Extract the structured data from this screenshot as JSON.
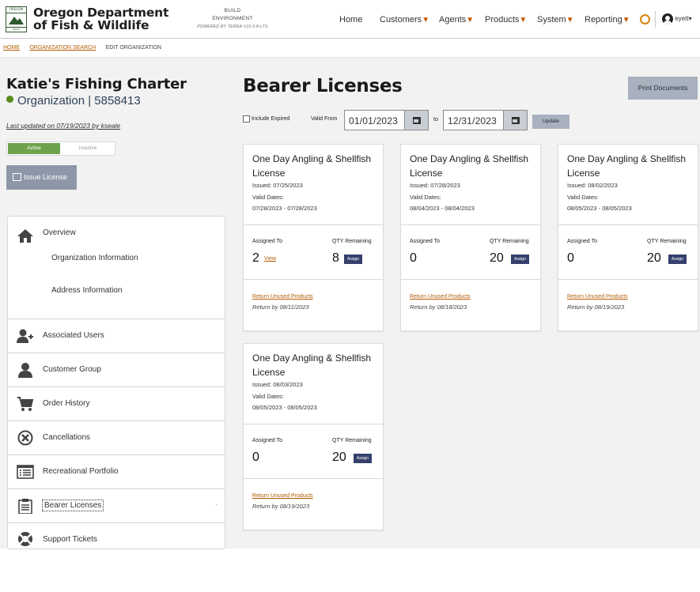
{
  "header": {
    "brand_line1": "Oregon Department",
    "brand_line2": "of Fish & Wildlife",
    "logo_top": "OREGON",
    "logo_bottom": "ODFW",
    "build_line1": "BUILD",
    "build_line2": "ENVIRONMENT",
    "build_line3": "POWERED BY TERRA V10.0.8-LTS",
    "nav": [
      {
        "label": "Home",
        "has_caret": false
      },
      {
        "label": "Customers",
        "has_caret": true
      },
      {
        "label": "Agents",
        "has_caret": true
      },
      {
        "label": "Products",
        "has_caret": true
      },
      {
        "label": "System",
        "has_caret": true
      },
      {
        "label": "Reporting",
        "has_caret": true
      }
    ],
    "caret": "▼",
    "user": "eyett",
    "user_caret": "▾",
    "help_icon": "lifebuoy-icon",
    "accent_color": "#c75a00"
  },
  "breadcrumb": {
    "home": "HOME",
    "search": "ORGANIZATION SEARCH",
    "current": "EDIT ORGANIZATION",
    "sep": "·"
  },
  "org": {
    "name": "Katie's Fishing Charter",
    "type": "Organization | 5858413",
    "updated": "Last updated on 07/19/2023 by kseale",
    "status_active": "Active",
    "status_inactive": "Inactive",
    "issue_label": "Issue License"
  },
  "sidebar": {
    "overview": "Overview",
    "org_info": "Organization Information",
    "address_info": "Address Information",
    "items": [
      {
        "label": "Associated Users",
        "icon": "user-plus-icon"
      },
      {
        "label": "Customer Group",
        "icon": "user-icon"
      },
      {
        "label": "Order History",
        "icon": "cart-icon"
      },
      {
        "label": "Cancellations",
        "icon": "x-circle-icon"
      },
      {
        "label": "Recreational Portfolio",
        "icon": "list-icon"
      },
      {
        "label": "Bearer Licenses",
        "icon": "clipboard-icon"
      },
      {
        "label": "Support Tickets",
        "icon": "lifebuoy-icon"
      }
    ],
    "active_marker": "·"
  },
  "main": {
    "title": "Bearer Licenses",
    "print_label": "Print Documents",
    "include_expired": "Include Expired",
    "valid_from_label": "Valid From",
    "from_date": "01/01/2023",
    "to_label": "to",
    "to_date": "12/31/2023",
    "update_label": "Update"
  },
  "cards_text": {
    "valid_dates_label": "Valid Dates:",
    "assigned_to_label": "Assigned To",
    "qty_label": "QTY Remaining",
    "assign_label": "Assign",
    "view_label": "View",
    "return_label": "Return Unused Products"
  },
  "cards": [
    {
      "title": "One Day Angling & Shellfish License",
      "issued": "Issued: 07/25/2023",
      "valid": "07/28/2023 - 07/28/2023",
      "assigned": "2",
      "qty": "8",
      "return_by": "Return by 08/11/2023",
      "has_view": true
    },
    {
      "title": "One Day Angling & Shellfish License",
      "issued": "Issued: 07/28/2023",
      "valid": "08/04/2023 - 08/04/2023",
      "assigned": "0",
      "qty": "20",
      "return_by": "Return by 08/18/2023",
      "has_view": false
    },
    {
      "title": "One Day Angling & Shellfish License",
      "issued": "Issued: 08/02/2023",
      "valid": "08/05/2023 - 08/05/2023",
      "assigned": "0",
      "qty": "20",
      "return_by": "Return by 08/19/2023",
      "has_view": false
    },
    {
      "title": "One Day Angling & Shellfish License",
      "issued": "Issued: 08/03/2023",
      "valid": "08/05/2023 - 08/05/2023",
      "assigned": "0",
      "qty": "20",
      "return_by": "Return by 08/19/2023",
      "has_view": false
    }
  ]
}
